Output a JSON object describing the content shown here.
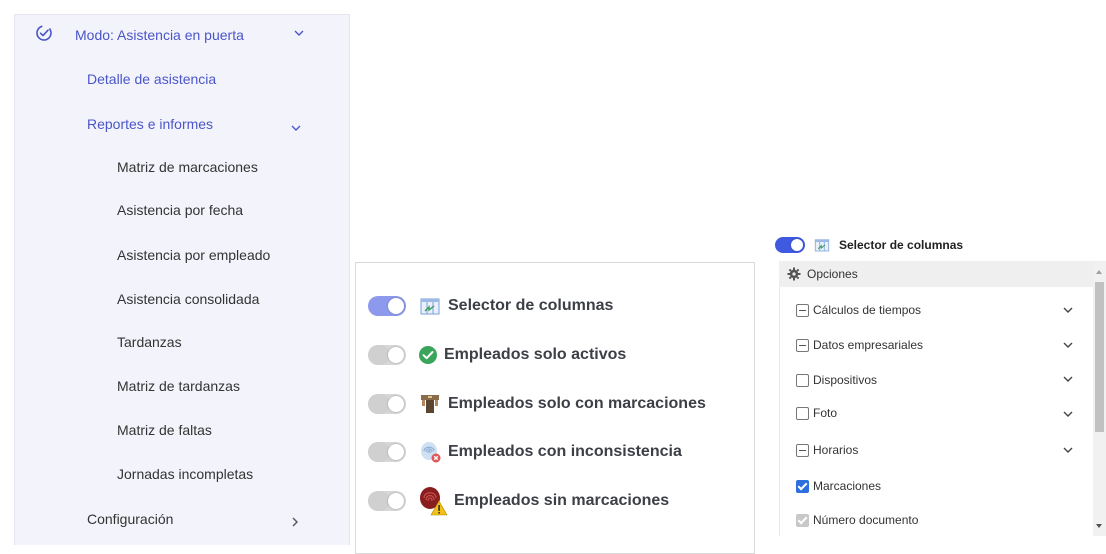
{
  "sidebar": {
    "mode_label": "Modo: Asistencia en puerta",
    "items": [
      {
        "label": "Detalle de asistencia",
        "level": 1
      },
      {
        "label": "Reportes e informes",
        "level": 1,
        "expanded": true
      },
      {
        "label": "Matriz de marcaciones",
        "level": 2
      },
      {
        "label": "Asistencia por fecha",
        "level": 2
      },
      {
        "label": "Asistencia por empleado",
        "level": 2
      },
      {
        "label": "Asistencia consolidada",
        "level": 2
      },
      {
        "label": "Tardanzas",
        "level": 2
      },
      {
        "label": "Matriz de tardanzas",
        "level": 2
      },
      {
        "label": "Matriz de faltas",
        "level": 2
      },
      {
        "label": "Jornadas incompletas",
        "level": 2
      },
      {
        "label": "Configuración",
        "level": 1,
        "expanded": false
      }
    ]
  },
  "options_panel": {
    "items": [
      {
        "label": "Selector de columnas",
        "on": true,
        "icon": "column-selector-icon"
      },
      {
        "label": "Empleados solo activos",
        "on": false,
        "icon": "green-check-icon"
      },
      {
        "label": "Empleados solo con marcaciones",
        "on": false,
        "icon": "turnstile-icon"
      },
      {
        "label": "Empleados con inconsistencia",
        "on": false,
        "icon": "fingerprint-error-icon"
      },
      {
        "label": "Empleados sin marcaciones",
        "on": false,
        "icon": "fingerprint-warning-icon"
      }
    ]
  },
  "column_selector": {
    "title": "Selector de columnas",
    "enabled": true,
    "options_label": "Opciones",
    "items": [
      {
        "label": "Cálculos de tiempos",
        "state": "partial",
        "expandable": true
      },
      {
        "label": "Datos empresariales",
        "state": "partial",
        "expandable": true
      },
      {
        "label": "Dispositivos",
        "state": "unchecked",
        "expandable": true
      },
      {
        "label": "Foto",
        "state": "unchecked",
        "expandable": true
      },
      {
        "label": "Horarios",
        "state": "partial",
        "expandable": true
      },
      {
        "label": "Marcaciones",
        "state": "checked",
        "expandable": false
      },
      {
        "label": "Número documento",
        "state": "disabled-checked",
        "expandable": false
      }
    ]
  },
  "colors": {
    "accent": "#4a55c9",
    "toggle_on": "#8d99ec",
    "toggle_on_small": "#3f5ae0",
    "check_blue": "#2d6fdd",
    "sidebar_bg": "#f3f4fb"
  }
}
